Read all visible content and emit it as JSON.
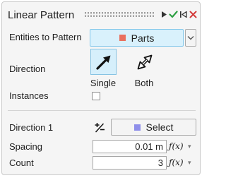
{
  "panel": {
    "title": "Linear Pattern",
    "header_icons": [
      "run-icon",
      "checkmark-icon",
      "skip-to-start-icon",
      "close-icon"
    ]
  },
  "entities": {
    "label": "Entities to Pattern",
    "button_label": "Parts",
    "button_swatch_color": "#e9705f"
  },
  "direction": {
    "label": "Direction",
    "options": [
      {
        "label": "Single",
        "icon": "single-arrow-icon",
        "selected": true
      },
      {
        "label": "Both",
        "icon": "double-arrow-icon",
        "selected": false
      }
    ]
  },
  "instances": {
    "label": "Instances",
    "checked": false
  },
  "direction1": {
    "label": "Direction 1",
    "flip_icon": "plus-minus-icon",
    "button_label": "Select",
    "button_swatch_color": "#8f8fea"
  },
  "spacing": {
    "label": "Spacing",
    "value": "0.01 m",
    "fx_label": "ƒ(x)"
  },
  "count": {
    "label": "Count",
    "value": "3",
    "fx_label": "ƒ(x)"
  },
  "colors": {
    "accent_blue": "#d9f1fc",
    "check_green": "#2ea043",
    "close_red": "#d33b3b"
  }
}
